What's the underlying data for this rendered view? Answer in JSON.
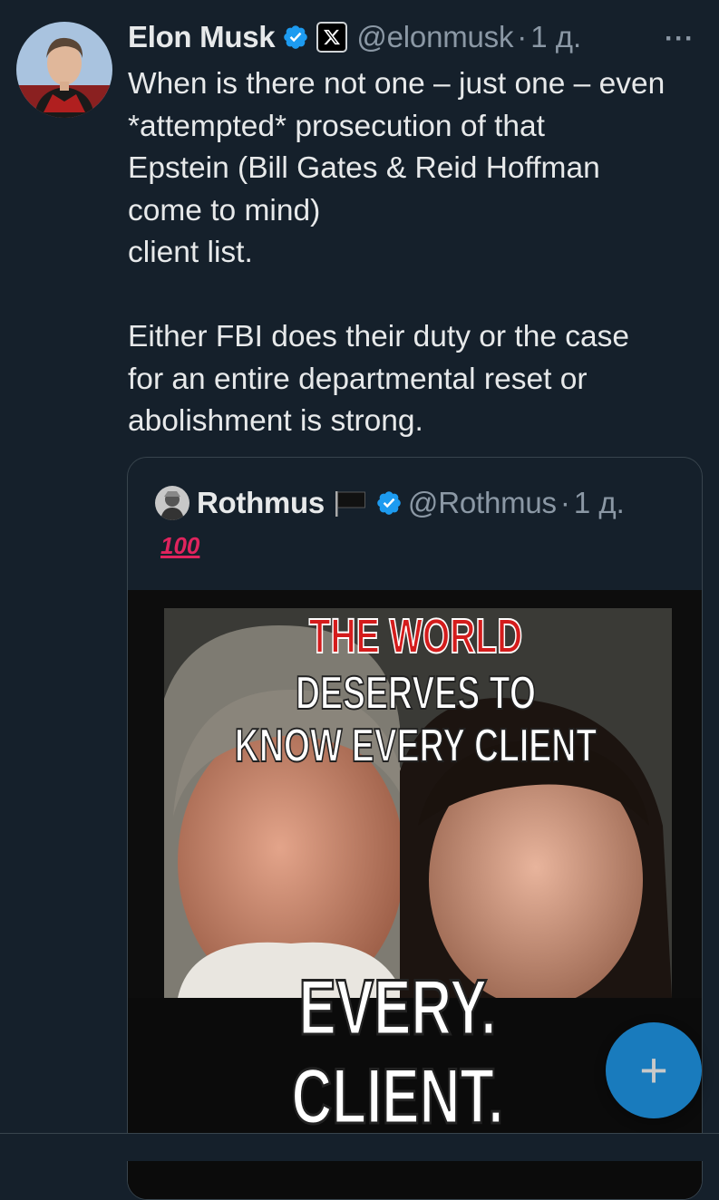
{
  "tweet": {
    "author_name": "Elon Musk",
    "author_handle": "@elonmusk",
    "separator": "·",
    "time": "1 д.",
    "more_label": "···",
    "body_lines_1": [
      "When is there not one – just one – even",
      "*attempted* prosecution of that",
      "Epstein (Bill Gates & Reid Hoffman",
      "come to mind)",
      "client list."
    ],
    "body_lines_2": [
      "Either FBI does their duty or the case",
      "for an entire departmental reset or",
      "abolishment is strong."
    ]
  },
  "quoted": {
    "author_name": "Rothmus",
    "author_handle": "@Rothmus",
    "separator": "·",
    "time": "1 д.",
    "body": "100",
    "image_text": {
      "line1": "THE WORLD",
      "line2": "DESERVES TO",
      "line3": "KNOW EVERY CLIENT",
      "line4": "EVERY.",
      "line5": "CLIENT."
    }
  },
  "fab_label": "+",
  "colors": {
    "background": "#15202b",
    "text": "#e7e9ea",
    "muted": "#8b98a5",
    "accent": "#1d9bf0",
    "border": "#38444d"
  },
  "icons": {
    "verified": "verified-badge-icon",
    "affiliate": "x-logo-icon",
    "flag": "black-flag-icon",
    "emoji": "hundred-points-icon"
  }
}
